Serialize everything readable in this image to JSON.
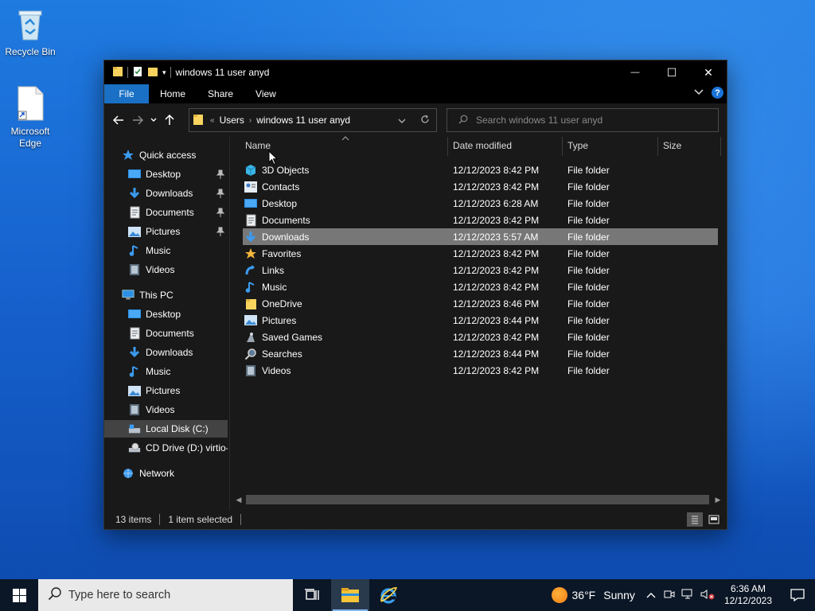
{
  "desktop": {
    "icons": [
      {
        "label": "Recycle Bin"
      },
      {
        "label": "Microsoft Edge"
      }
    ]
  },
  "window": {
    "title": "windows 11 user anyd",
    "controls": {
      "minimize": "—",
      "maximize": "☐",
      "close": "✕"
    },
    "ribbon_tabs": [
      "File",
      "Home",
      "Share",
      "View"
    ],
    "help_label": "?",
    "address": {
      "overflow": "«",
      "crumbs": [
        "Users",
        "windows 11 user anyd"
      ]
    },
    "search": {
      "placeholder": "Search windows 11 user anyd"
    },
    "tree": [
      {
        "label": "Quick access",
        "icon": "star-icon",
        "level": 0,
        "pinned": false
      },
      {
        "label": "Desktop",
        "icon": "desktop-icon",
        "level": 1,
        "pinned": true
      },
      {
        "label": "Downloads",
        "icon": "downloads-icon",
        "level": 1,
        "pinned": true
      },
      {
        "label": "Documents",
        "icon": "documents-icon",
        "level": 1,
        "pinned": true
      },
      {
        "label": "Pictures",
        "icon": "pictures-icon",
        "level": 1,
        "pinned": true
      },
      {
        "label": "Music",
        "icon": "music-icon",
        "level": 1,
        "pinned": false
      },
      {
        "label": "Videos",
        "icon": "videos-icon",
        "level": 1,
        "pinned": false
      },
      {
        "label": "This PC",
        "icon": "computer-icon",
        "level": 0,
        "pinned": false
      },
      {
        "label": "Desktop",
        "icon": "desktop-icon",
        "level": 1,
        "pinned": false
      },
      {
        "label": "Documents",
        "icon": "documents-icon",
        "level": 1,
        "pinned": false
      },
      {
        "label": "Downloads",
        "icon": "downloads-icon",
        "level": 1,
        "pinned": false
      },
      {
        "label": "Music",
        "icon": "music-icon",
        "level": 1,
        "pinned": false
      },
      {
        "label": "Pictures",
        "icon": "pictures-icon",
        "level": 1,
        "pinned": false
      },
      {
        "label": "Videos",
        "icon": "videos-icon",
        "level": 1,
        "pinned": false
      },
      {
        "label": "Local Disk (C:)",
        "icon": "drive-icon",
        "level": 1,
        "pinned": false,
        "selected": true
      },
      {
        "label": "CD Drive (D:) virtio-",
        "icon": "cd-drive-icon",
        "level": 1,
        "pinned": false
      },
      {
        "label": "Network",
        "icon": "network-icon",
        "level": 0,
        "pinned": false
      }
    ],
    "columns": [
      "Name",
      "Date modified",
      "Type",
      "Size"
    ],
    "files": [
      {
        "name": "3D Objects",
        "date": "12/12/2023 8:42 PM",
        "type": "File folder",
        "icon": "3d-objects-icon"
      },
      {
        "name": "Contacts",
        "date": "12/12/2023 8:42 PM",
        "type": "File folder",
        "icon": "contacts-icon"
      },
      {
        "name": "Desktop",
        "date": "12/12/2023 6:28 AM",
        "type": "File folder",
        "icon": "desktop-icon"
      },
      {
        "name": "Documents",
        "date": "12/12/2023 8:42 PM",
        "type": "File folder",
        "icon": "documents-icon"
      },
      {
        "name": "Downloads",
        "date": "12/12/2023 5:57 AM",
        "type": "File folder",
        "icon": "downloads-icon",
        "selected": true
      },
      {
        "name": "Favorites",
        "date": "12/12/2023 8:42 PM",
        "type": "File folder",
        "icon": "favorites-icon"
      },
      {
        "name": "Links",
        "date": "12/12/2023 8:42 PM",
        "type": "File folder",
        "icon": "links-icon"
      },
      {
        "name": "Music",
        "date": "12/12/2023 8:42 PM",
        "type": "File folder",
        "icon": "music-icon"
      },
      {
        "name": "OneDrive",
        "date": "12/12/2023 8:46 PM",
        "type": "File folder",
        "icon": "folder-icon"
      },
      {
        "name": "Pictures",
        "date": "12/12/2023 8:44 PM",
        "type": "File folder",
        "icon": "pictures-icon"
      },
      {
        "name": "Saved Games",
        "date": "12/12/2023 8:42 PM",
        "type": "File folder",
        "icon": "saved-games-icon"
      },
      {
        "name": "Searches",
        "date": "12/12/2023 8:44 PM",
        "type": "File folder",
        "icon": "searches-icon"
      },
      {
        "name": "Videos",
        "date": "12/12/2023 8:42 PM",
        "type": "File folder",
        "icon": "videos-icon"
      }
    ],
    "status": {
      "items": "13 items",
      "selected": "1 item selected"
    }
  },
  "taskbar": {
    "search_placeholder": "Type here to search",
    "weather": {
      "temp": "36°F",
      "condition": "Sunny"
    },
    "clock": {
      "time": "6:36 AM",
      "date": "12/12/2023"
    }
  },
  "colors": {
    "accent": "#1a70c4",
    "window_bg": "#191919",
    "selection": "#777777",
    "folder": "#f8d35e"
  }
}
